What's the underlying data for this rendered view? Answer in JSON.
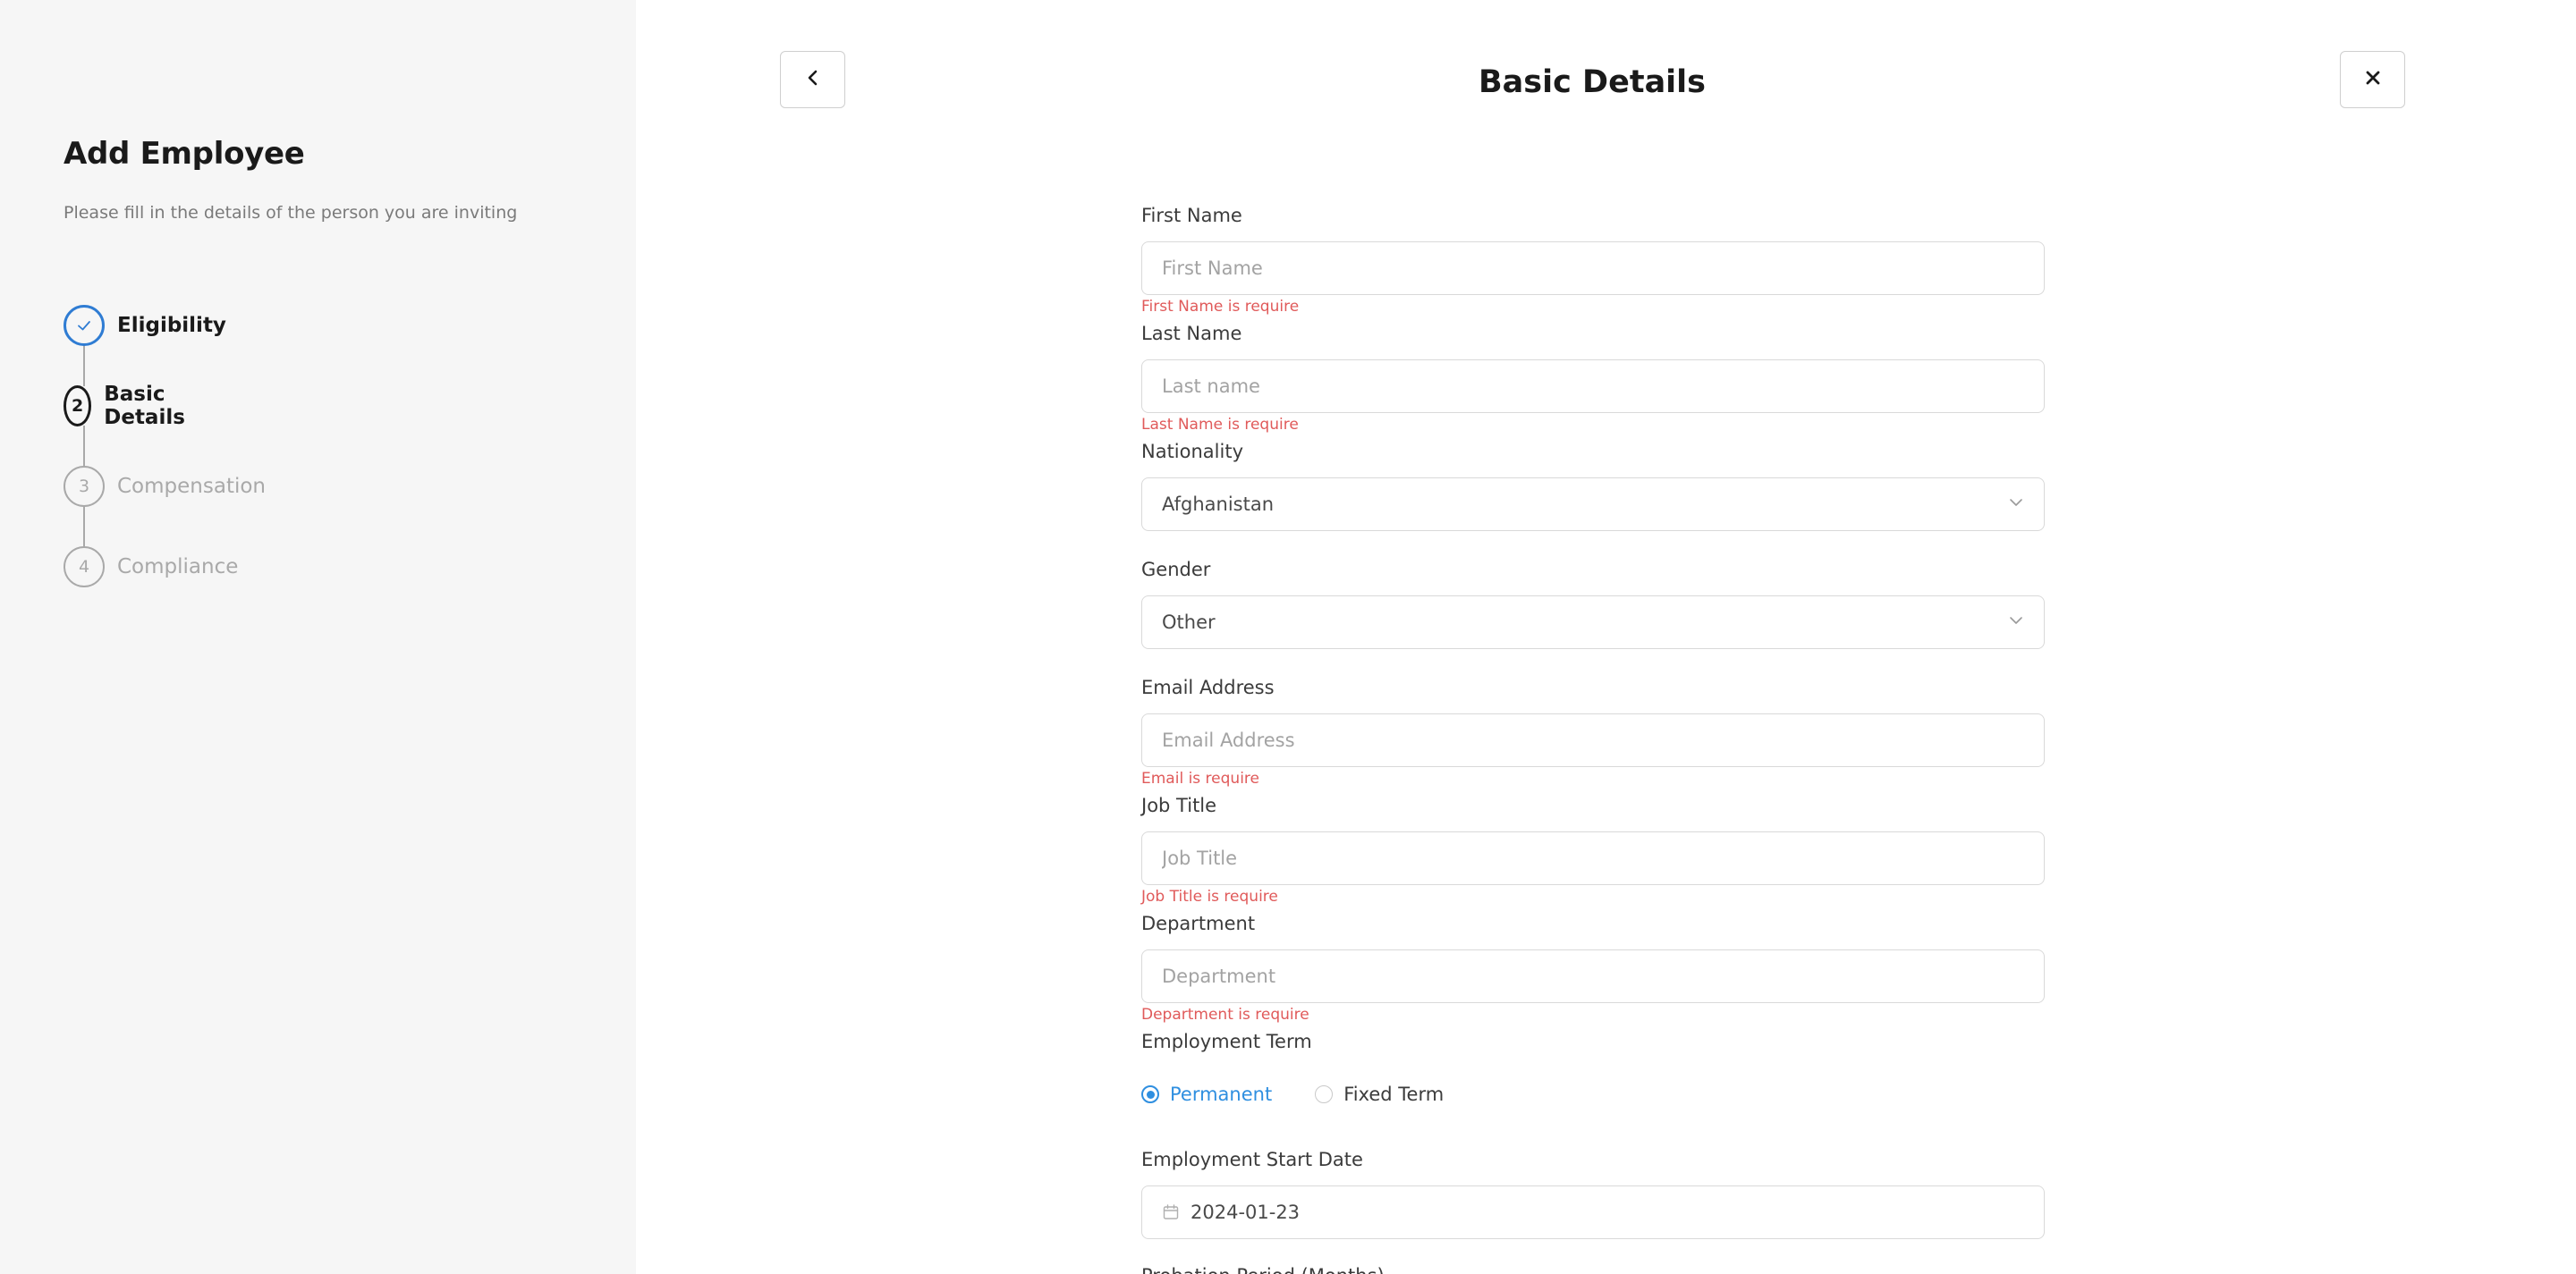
{
  "sidebar": {
    "title": "Add Employee",
    "subtitle": "Please fill in the details of the person you are inviting",
    "steps": [
      {
        "number": "✓",
        "label": "Eligibility",
        "state": "done"
      },
      {
        "number": "2",
        "label": "Basic Details",
        "state": "active"
      },
      {
        "number": "3",
        "label": "Compensation",
        "state": "todo"
      },
      {
        "number": "4",
        "label": "Compliance",
        "state": "todo"
      }
    ]
  },
  "header": {
    "title": "Basic Details",
    "back_icon": "chevron-left-icon",
    "close_icon": "close-icon"
  },
  "form": {
    "first_name": {
      "label": "First Name",
      "placeholder": "First Name",
      "value": "",
      "error": "First Name is require"
    },
    "last_name": {
      "label": "Last Name",
      "placeholder": "Last name",
      "value": "",
      "error": "Last Name is require"
    },
    "nationality": {
      "label": "Nationality",
      "value": "Afghanistan"
    },
    "gender": {
      "label": "Gender",
      "value": "Other"
    },
    "email": {
      "label": "Email Address",
      "placeholder": "Email Address",
      "value": "",
      "error": "Email is require"
    },
    "job_title": {
      "label": "Job Title",
      "placeholder": "Job Title",
      "value": "",
      "error": "Job Title is require"
    },
    "department": {
      "label": "Department",
      "placeholder": "Department",
      "value": "",
      "error": "Department is require"
    },
    "employment_term": {
      "label": "Employment Term",
      "options": [
        {
          "label": "Permanent",
          "checked": true
        },
        {
          "label": "Fixed Term",
          "checked": false
        }
      ]
    },
    "start_date": {
      "label": "Employment Start Date",
      "value": "2024-01-23"
    },
    "next_label": "Probation Period (Months)"
  },
  "colors": {
    "accent": "#2f8fe0",
    "error": "#e05a5a",
    "sidebar_bg": "#f6f6f6"
  }
}
